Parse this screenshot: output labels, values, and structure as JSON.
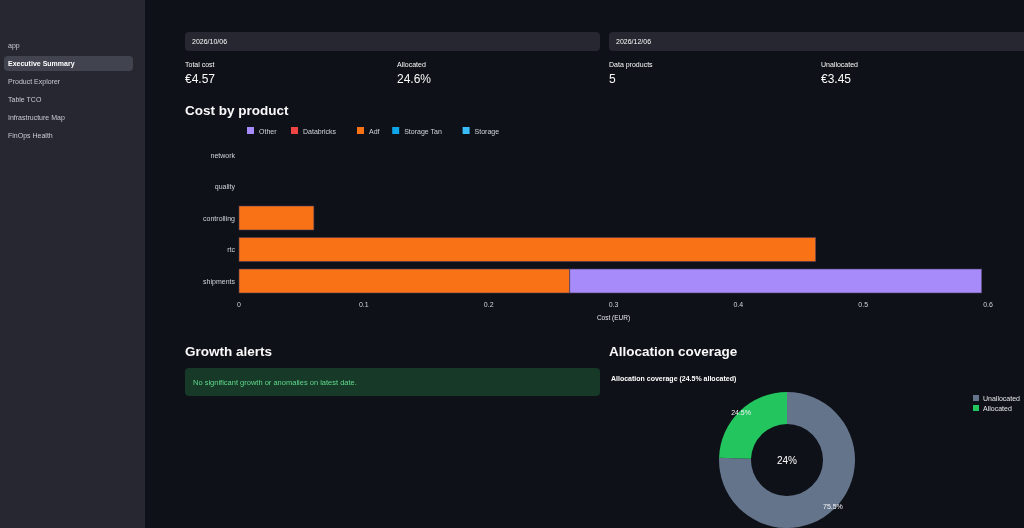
{
  "sidebar": {
    "items": [
      {
        "label": "app",
        "selected": false
      },
      {
        "label": "Executive Summary",
        "selected": true
      },
      {
        "label": "Product Explorer",
        "selected": false
      },
      {
        "label": "Table TCO",
        "selected": false
      },
      {
        "label": "Infrastructure Map",
        "selected": false
      },
      {
        "label": "FinOps Health",
        "selected": false
      }
    ]
  },
  "date_range": {
    "start": "2026/10/06",
    "end": "2026/12/06"
  },
  "metrics": [
    {
      "label": "Total cost",
      "value": "€4.57"
    },
    {
      "label": "Allocated",
      "value": "24.6%"
    },
    {
      "label": "Data products",
      "value": "5"
    },
    {
      "label": "Unallocated",
      "value": "€3.45"
    }
  ],
  "cost_by_product": {
    "heading": "Cost by product",
    "chart_data": {
      "type": "bar",
      "orientation": "horizontal",
      "stacked": true,
      "xlabel": "Cost (EUR)",
      "categories": [
        "network",
        "quality",
        "controlling",
        "rtc",
        "shipments"
      ],
      "series": [
        {
          "name": "Other",
          "color": "#a78bfa",
          "values": [
            null,
            null,
            null,
            null,
            0.33
          ]
        },
        {
          "name": "Databricks",
          "color": "#ef4444",
          "values": [
            null,
            null,
            null,
            null,
            null
          ]
        },
        {
          "name": "Adf",
          "color": "#f97316",
          "values": [
            null,
            null,
            0.06,
            0.462,
            0.265
          ]
        },
        {
          "name": "Storage Tan",
          "color": "#0ea5e9",
          "values": [
            null,
            null,
            null,
            null,
            null
          ]
        },
        {
          "name": "Storage",
          "color": "#38bdf8",
          "values": [
            null,
            null,
            null,
            null,
            null
          ]
        }
      ],
      "xlim": [
        0,
        0.6
      ],
      "xticks": [
        0,
        0.1,
        0.2,
        0.3,
        0.4,
        0.5,
        0.6
      ],
      "legend": true
    }
  },
  "growth_alerts": {
    "heading": "Growth alerts",
    "message": "No significant growth or anomalies on latest date."
  },
  "allocation_coverage": {
    "heading": "Allocation coverage",
    "chart_data": {
      "type": "donut",
      "title": "Allocation coverage (24.5% allocated)",
      "categories": [
        "Unallocated",
        "Allocated"
      ],
      "series": [
        {
          "values": [
            75.5,
            24.5
          ]
        }
      ],
      "legend": true,
      "colors": [
        "#64748b",
        "#22c55e"
      ],
      "value_labels": [
        "75.5%",
        "24.5%"
      ],
      "annotations": [
        "24%"
      ]
    }
  }
}
